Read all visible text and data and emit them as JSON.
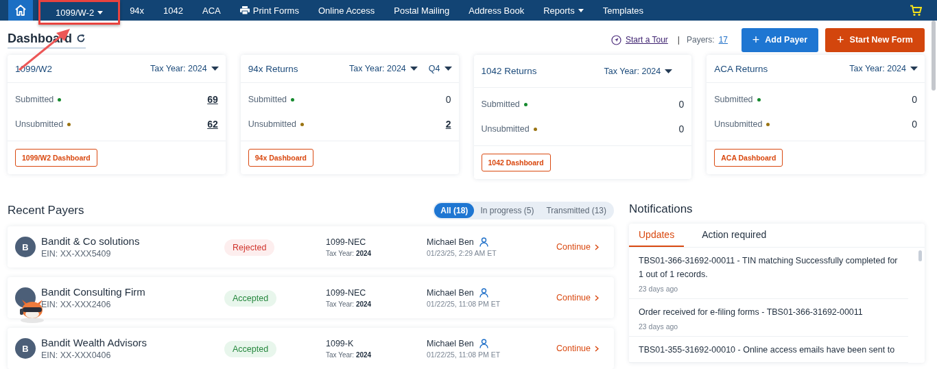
{
  "nav": {
    "items": [
      {
        "label": "1099/W-2",
        "dropdown": true,
        "highlighted": true
      },
      {
        "label": "94x",
        "dropdown": false,
        "highlighted": false
      },
      {
        "label": "1042",
        "dropdown": false,
        "highlighted": false
      },
      {
        "label": "ACA",
        "dropdown": false,
        "highlighted": false
      },
      {
        "label": "Print Forms",
        "dropdown": false,
        "highlighted": false,
        "kind": "print"
      },
      {
        "label": "Online Access",
        "dropdown": false,
        "highlighted": false
      },
      {
        "label": "Postal Mailing",
        "dropdown": false,
        "highlighted": false
      },
      {
        "label": "Address Book",
        "dropdown": false,
        "highlighted": false
      },
      {
        "label": "Reports",
        "dropdown": true,
        "highlighted": false
      },
      {
        "label": "Templates",
        "dropdown": false,
        "highlighted": false
      }
    ]
  },
  "header": {
    "title": "Dashboard",
    "tour": "Start a Tour",
    "separator": "|",
    "payers_label": "Payers:",
    "payers_count": "17",
    "add_payer_icon": "+",
    "add_payer": "Add Payer",
    "start_form_icon": "+",
    "start_form": "Start New Form"
  },
  "cards": [
    {
      "title": "1099/W2",
      "selectors": [
        "Tax Year: 2024"
      ],
      "rows": [
        {
          "label": "Submitted",
          "color": "#168a2e",
          "value": "69",
          "link": true
        },
        {
          "label": "Unsubmitted",
          "color": "#9a7412",
          "value": "62",
          "link": true
        }
      ],
      "button": "1099/W2 Dashboard"
    },
    {
      "title": "94x Returns",
      "selectors": [
        "Tax Year: 2024",
        "Q4"
      ],
      "rows": [
        {
          "label": "Submitted",
          "color": "#168a2e",
          "value": "0",
          "link": false
        },
        {
          "label": "Unsubmitted",
          "color": "#9a7412",
          "value": "2",
          "link": true
        }
      ],
      "button": "94x Dashboard"
    },
    {
      "title": "1042 Returns",
      "selectors": [
        "Tax Year: 2024"
      ],
      "rows": [
        {
          "label": "Submitted",
          "color": "#168a2e",
          "value": "0",
          "link": false
        },
        {
          "label": "Unsubmitted",
          "color": "#9a7412",
          "value": "0",
          "link": false
        }
      ],
      "button": "1042 Dashboard"
    },
    {
      "title": "ACA Returns",
      "selectors": [
        "Tax Year: 2024"
      ],
      "rows": [
        {
          "label": "Submitted",
          "color": "#168a2e",
          "value": "0",
          "link": false
        },
        {
          "label": "Unsubmitted",
          "color": "#9a7412",
          "value": "0",
          "link": false
        }
      ],
      "button": "ACA Dashboard"
    }
  ],
  "recent_payers": {
    "title": "Recent Payers",
    "filters": [
      {
        "label": "All (18)",
        "selected": true
      },
      {
        "label": "In progress (5)",
        "selected": false
      },
      {
        "label": "Transmitted (13)",
        "selected": false
      }
    ],
    "rows": [
      {
        "avatar": "B",
        "name": "Bandit & Co solutions",
        "ein": "EIN: XX-XXX5409",
        "status": "Rejected",
        "kind": "rejected",
        "form": "1099-NEC",
        "tax_year_label": "Tax Year:",
        "tax_year": "2024",
        "user": "Michael Ben",
        "date": "01/23/25, 2:29 AM ET",
        "action": "Continue"
      },
      {
        "name": "Bandit Consulting Firm",
        "ein": "EIN: XX-XXX2406",
        "status": "Accepted",
        "kind": "accepted",
        "form": "1099-NEC",
        "tax_year_label": "Tax Year:",
        "tax_year": "2024",
        "user": "Michael Ben",
        "date": "01/22/25, 11:08 PM ET",
        "action": "Continue"
      },
      {
        "avatar": "B",
        "name": "Bandit Wealth Advisors",
        "ein": "EIN: XX-XXX0406",
        "status": "Accepted",
        "kind": "accepted",
        "form": "1099-K",
        "tax_year_label": "Tax Year:",
        "tax_year": "2024",
        "user": "Michael Ben",
        "date": "01/22/25, 11:08 PM ET",
        "action": "Continue"
      }
    ]
  },
  "notifications": {
    "title": "Notifications",
    "tabs": [
      {
        "label": "Updates",
        "selected": true
      },
      {
        "label": "Action required",
        "selected": false
      }
    ],
    "items": [
      {
        "text": "TBS01-366-31692-00011 - TIN matching Successfully completed for 1 out of 1 records.",
        "time": "23 days ago"
      },
      {
        "text": "Order received for e-filing forms - TBS01-366-31692-00011",
        "time": "23 days ago"
      },
      {
        "text": "TBS01-355-31692-00010 - Online access emails have been sent to"
      }
    ]
  }
}
